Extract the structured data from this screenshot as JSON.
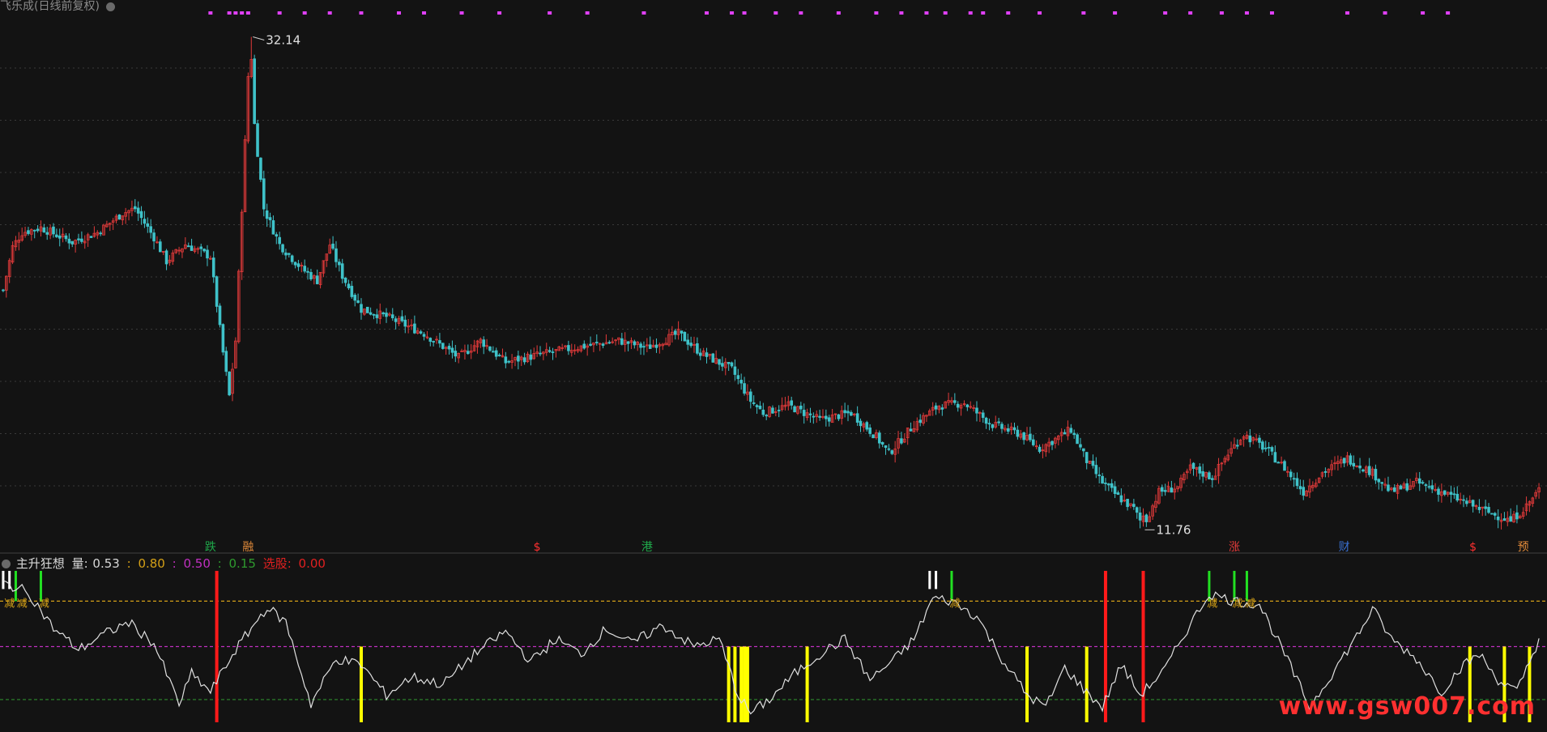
{
  "colors": {
    "background": "#131313",
    "up": "#e23a3a",
    "down": "#3fc2c9",
    "grid": "#3a3a3a",
    "buy_dots": "#e040fb",
    "osc_line": "#e0e0e0",
    "level_high": "#d4a017",
    "level_mid": "#c030c0",
    "level_low": "#2e8b2e",
    "red_bar": "#ff1a1a",
    "yellow_bar": "#ffff00",
    "green_bar": "#22e022",
    "white_bar": "#ffffff",
    "watermark": "#ff3030"
  },
  "main": {
    "title": "飞乐成(日线前复权)",
    "title_icon": "settings-icon",
    "high_label": "32.14",
    "low_label": "11.76"
  },
  "event_tags": [
    {
      "text": "跌",
      "bar": 66,
      "color": "#1fa84a"
    },
    {
      "text": "融",
      "bar": 78,
      "color": "#e08a3a"
    },
    {
      "text": "$",
      "bar": 170,
      "color": "#ff3030"
    },
    {
      "text": "港",
      "bar": 205,
      "color": "#1fa84a"
    },
    {
      "text": "涨",
      "bar": 392,
      "color": "#e23a3a"
    },
    {
      "text": "财",
      "bar": 427,
      "color": "#3a6fd0"
    },
    {
      "text": "$",
      "bar": 468,
      "color": "#ff3030"
    },
    {
      "text": "预",
      "bar": 484,
      "color": "#e08a3a"
    }
  ],
  "indicator": {
    "name": "主升狂想",
    "field_label": "量:",
    "value": "0.53",
    "sep1": ":",
    "level_high": "0.80",
    "sep2": ":",
    "level_mid": "0.50",
    "sep3": ":",
    "level_low": "0.15",
    "pick_label": "选股:",
    "pick_value": "0.00",
    "reduce_label": "减"
  },
  "watermark": "www.gsw007.com",
  "chart_data": [
    {
      "type": "candlestick",
      "title": "飞乐成(日线前复权)",
      "bar_count": 490,
      "price_range": [
        11.5,
        33.0
      ],
      "high": 32.14,
      "low": 11.76,
      "anchors": [
        [
          0,
          21.6
        ],
        [
          3,
          23.4
        ],
        [
          6,
          24.0
        ],
        [
          12,
          24.2
        ],
        [
          22,
          23.6
        ],
        [
          30,
          24.0
        ],
        [
          38,
          24.8
        ],
        [
          42,
          25.0
        ],
        [
          48,
          23.8
        ],
        [
          52,
          22.8
        ],
        [
          58,
          23.5
        ],
        [
          66,
          23.0
        ],
        [
          70,
          19.0
        ],
        [
          72,
          17.2
        ],
        [
          74,
          19.5
        ],
        [
          76,
          25.0
        ],
        [
          78,
          30.5
        ],
        [
          80,
          28.5
        ],
        [
          83,
          25.0
        ],
        [
          88,
          23.5
        ],
        [
          95,
          22.5
        ],
        [
          100,
          22.0
        ],
        [
          104,
          23.5
        ],
        [
          108,
          22.2
        ],
        [
          114,
          20.8
        ],
        [
          122,
          20.5
        ],
        [
          134,
          19.8
        ],
        [
          145,
          18.8
        ],
        [
          152,
          19.5
        ],
        [
          160,
          18.6
        ],
        [
          170,
          18.9
        ],
        [
          182,
          19.2
        ],
        [
          196,
          19.5
        ],
        [
          205,
          19.2
        ],
        [
          215,
          19.8
        ],
        [
          222,
          19.0
        ],
        [
          232,
          18.3
        ],
        [
          238,
          17.0
        ],
        [
          242,
          16.5
        ],
        [
          250,
          16.8
        ],
        [
          260,
          16.2
        ],
        [
          270,
          16.5
        ],
        [
          278,
          15.5
        ],
        [
          282,
          14.8
        ],
        [
          290,
          16.0
        ],
        [
          298,
          16.8
        ],
        [
          306,
          16.9
        ],
        [
          315,
          16.0
        ],
        [
          324,
          15.6
        ],
        [
          330,
          15.0
        ],
        [
          340,
          15.8
        ],
        [
          345,
          14.5
        ],
        [
          350,
          13.6
        ],
        [
          355,
          13.0
        ],
        [
          360,
          12.5
        ],
        [
          363,
          11.76
        ],
        [
          368,
          13.2
        ],
        [
          374,
          13.4
        ],
        [
          378,
          14.2
        ],
        [
          385,
          13.8
        ],
        [
          390,
          14.8
        ],
        [
          395,
          15.6
        ],
        [
          402,
          15.0
        ],
        [
          408,
          14.2
        ],
        [
          414,
          13.2
        ],
        [
          420,
          14.0
        ],
        [
          428,
          14.6
        ],
        [
          436,
          14.0
        ],
        [
          442,
          13.2
        ],
        [
          450,
          13.6
        ],
        [
          458,
          13.2
        ],
        [
          465,
          12.8
        ],
        [
          472,
          12.4
        ],
        [
          480,
          12.0
        ],
        [
          485,
          12.6
        ],
        [
          489,
          13.3
        ]
      ]
    },
    {
      "type": "line",
      "name": "主升狂想",
      "ylim": [
        0,
        1
      ],
      "levels": [
        0.8,
        0.5,
        0.15
      ],
      "current": 0.53,
      "anchors": [
        [
          0,
          0.92
        ],
        [
          8,
          0.86
        ],
        [
          16,
          0.62
        ],
        [
          24,
          0.48
        ],
        [
          32,
          0.58
        ],
        [
          40,
          0.66
        ],
        [
          48,
          0.52
        ],
        [
          56,
          0.12
        ],
        [
          60,
          0.32
        ],
        [
          66,
          0.2
        ],
        [
          74,
          0.48
        ],
        [
          84,
          0.76
        ],
        [
          90,
          0.66
        ],
        [
          98,
          0.12
        ],
        [
          106,
          0.42
        ],
        [
          114,
          0.38
        ],
        [
          122,
          0.18
        ],
        [
          130,
          0.3
        ],
        [
          140,
          0.25
        ],
        [
          150,
          0.45
        ],
        [
          160,
          0.6
        ],
        [
          168,
          0.4
        ],
        [
          176,
          0.55
        ],
        [
          184,
          0.45
        ],
        [
          192,
          0.62
        ],
        [
          200,
          0.52
        ],
        [
          210,
          0.64
        ],
        [
          220,
          0.5
        ],
        [
          228,
          0.55
        ],
        [
          234,
          0.18
        ],
        [
          238,
          0.06
        ],
        [
          244,
          0.15
        ],
        [
          252,
          0.32
        ],
        [
          260,
          0.45
        ],
        [
          268,
          0.55
        ],
        [
          276,
          0.28
        ],
        [
          284,
          0.42
        ],
        [
          290,
          0.55
        ],
        [
          296,
          0.82
        ],
        [
          302,
          0.8
        ],
        [
          310,
          0.7
        ],
        [
          318,
          0.42
        ],
        [
          326,
          0.18
        ],
        [
          332,
          0.1
        ],
        [
          338,
          0.36
        ],
        [
          344,
          0.22
        ],
        [
          350,
          0.1
        ],
        [
          356,
          0.38
        ],
        [
          362,
          0.18
        ],
        [
          370,
          0.35
        ],
        [
          376,
          0.58
        ],
        [
          384,
          0.85
        ],
        [
          392,
          0.8
        ],
        [
          400,
          0.78
        ],
        [
          408,
          0.45
        ],
        [
          416,
          0.1
        ],
        [
          424,
          0.35
        ],
        [
          432,
          0.6
        ],
        [
          436,
          0.75
        ],
        [
          442,
          0.55
        ],
        [
          450,
          0.42
        ],
        [
          458,
          0.2
        ],
        [
          464,
          0.36
        ],
        [
          470,
          0.45
        ],
        [
          476,
          0.28
        ],
        [
          482,
          0.2
        ],
        [
          489,
          0.55
        ]
      ],
      "red_bars": [
        68,
        351,
        363
      ],
      "yellow_bars": [
        114,
        231,
        233,
        235,
        236,
        237,
        256,
        326,
        345,
        467,
        478,
        486
      ],
      "green_bars": [
        4,
        12,
        302,
        384,
        392,
        396
      ],
      "white_bars": [
        0,
        2,
        295,
        297
      ],
      "reduce_markers": [
        2,
        6,
        13,
        303,
        385,
        393,
        397
      ],
      "buy_dots": [
        66,
        72,
        74,
        76,
        78,
        88,
        96,
        104,
        114,
        126,
        134,
        146,
        158,
        174,
        186,
        204,
        224,
        232,
        236,
        246,
        254,
        266,
        278,
        286,
        294,
        300,
        308,
        312,
        320,
        330,
        344,
        354,
        370,
        378,
        388,
        396,
        404,
        428,
        440,
        452,
        460
      ]
    }
  ]
}
